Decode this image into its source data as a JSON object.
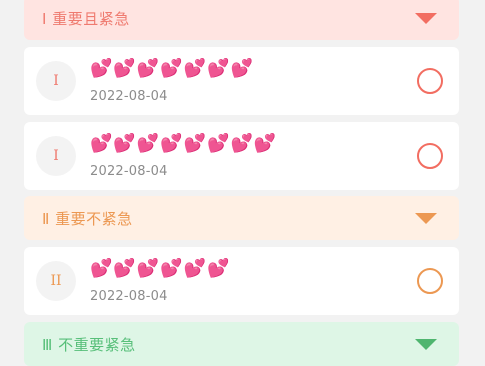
{
  "categories": {
    "important_urgent": {
      "label": "Ⅰ 重要且紧急",
      "color": "#ef7a6f",
      "icon": "chevron-down-icon"
    },
    "important_not_urgent": {
      "label": "Ⅱ 重要不紧急",
      "color": "#ec9852",
      "icon": "chevron-down-icon"
    },
    "not_important_urgent": {
      "label": "Ⅲ 不重要紧急",
      "color": "#57bf79",
      "icon": "chevron-down-icon"
    }
  },
  "tasks": [
    {
      "badge": "I",
      "title": "💕💕💕💕💕💕💕",
      "date": "2022-08-04",
      "status": "incomplete"
    },
    {
      "badge": "I",
      "title": "💕💕💕💕💕💕💕💕",
      "date": "2022-08-04",
      "status": "incomplete"
    },
    {
      "badge": "II",
      "title": "💕💕💕💕💕💕",
      "date": "2022-08-04",
      "status": "incomplete"
    }
  ]
}
